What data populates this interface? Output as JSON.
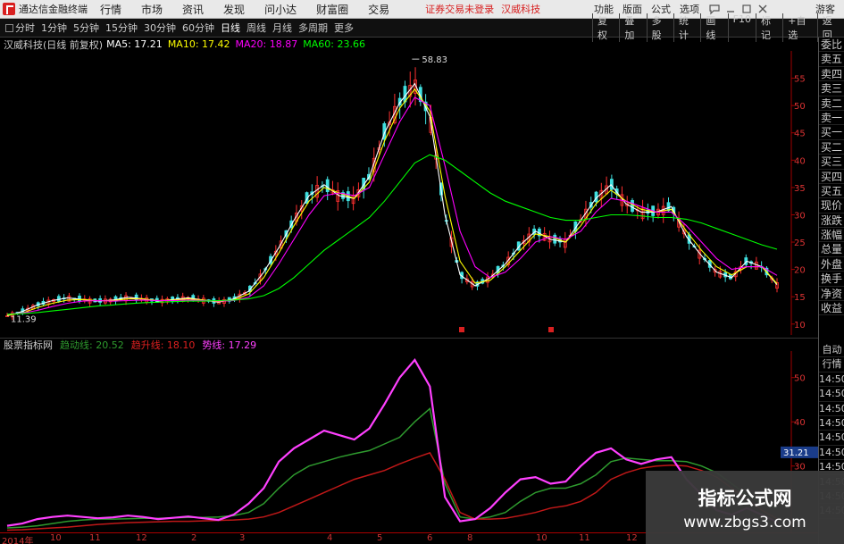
{
  "titlebar": {
    "app_name": "通达信金融终端",
    "menus": [
      "行情",
      "市场",
      "资讯",
      "发现",
      "问小达",
      "财富圈",
      "交易"
    ],
    "warning": "证券交易未登录",
    "stock_name": "汉威科技",
    "right_items": [
      "功能",
      "版面",
      "公式",
      "选项"
    ],
    "guest": "游客"
  },
  "toolbar": {
    "periods": [
      "分时",
      "1分钟",
      "5分钟",
      "15分钟",
      "30分钟",
      "60分钟",
      "日线",
      "周线",
      "月线",
      "多周期",
      "更多"
    ],
    "active_period": "日线",
    "tools": [
      "复权",
      "叠加",
      "多股",
      "统计",
      "画线",
      "F10",
      "标记",
      "+自选",
      "返回"
    ]
  },
  "infobar": {
    "stock_label": "汉威科技(日线 前复权)",
    "ma": [
      {
        "label": "MA5: 17.21",
        "color": "#ffffff"
      },
      {
        "label": "MA10: 17.42",
        "color": "#ffff00"
      },
      {
        "label": "MA20: 18.87",
        "color": "#ff00ff"
      },
      {
        "label": "MA60: 23.66",
        "color": "#00ff00"
      }
    ]
  },
  "right_panel": {
    "upper": [
      "委比",
      "卖五",
      "卖四",
      "卖三",
      "卖二",
      "卖一",
      "买一",
      "买二",
      "买三",
      "买四",
      "买五",
      "现价",
      "涨跌",
      "涨幅",
      "总量",
      "外盘",
      "换手",
      "净资",
      "收益"
    ],
    "lower": [
      "自动",
      "行情",
      "14:50",
      "14:50",
      "14:50",
      "14:50",
      "14:50",
      "14:50",
      "14:50",
      "14:50",
      "14:50",
      "14:50"
    ]
  },
  "indicator": {
    "name": "股票指标网",
    "values": [
      {
        "label": "趋动线: 20.52",
        "color": "#2e9a2e"
      },
      {
        "label": "趋升线: 18.10",
        "color": "#e02020"
      },
      {
        "label": "势线: 17.29",
        "color": "#ff40ff"
      }
    ],
    "current_price_badge": "31.21"
  },
  "time_axis": [
    "2014年",
    "10",
    "11",
    "12",
    "2",
    "3",
    "4",
    "5",
    "6",
    "8",
    "10",
    "11",
    "12"
  ],
  "watermark": {
    "line1": "指标公式网",
    "line2": "www.zbgs3.com"
  },
  "colors": {
    "up": "#ff3030",
    "down": "#40e0e0",
    "ma5": "#ffffff",
    "ma10": "#ffff00",
    "ma20": "#ff00ff",
    "ma60": "#00ff00",
    "axis": "#a00000"
  },
  "chart_data": [
    {
      "type": "candlestick",
      "title": "汉威科技(日线 前复权)",
      "ylim": [
        8,
        60
      ],
      "y_ticks": [
        10,
        15,
        20,
        25,
        30,
        35,
        40,
        45,
        50,
        55
      ],
      "annotations": [
        "58.83",
        "11.39"
      ],
      "series": [
        {
          "name": "MA5",
          "values": [
            11.5,
            12.3,
            13.5,
            14.3,
            14.8,
            14.5,
            14.2,
            14.4,
            14.9,
            14.6,
            14.2,
            14.5,
            14.8,
            14.4,
            14.0,
            14.6,
            16.0,
            19.5,
            24.0,
            29.0,
            33.5,
            35.5,
            33.5,
            33.0,
            37.0,
            45.0,
            50.5,
            54.0,
            48.0,
            30.0,
            19.0,
            17.0,
            18.5,
            21.0,
            24.5,
            27.0,
            25.5,
            25.0,
            29.0,
            33.0,
            35.5,
            32.0,
            30.5,
            30.5,
            31.5,
            26.0,
            22.5,
            19.5,
            18.5,
            21.5,
            20.5,
            17.2
          ]
        },
        {
          "name": "MA10",
          "values": [
            11.6,
            12.0,
            13.0,
            13.8,
            14.4,
            14.5,
            14.3,
            14.3,
            14.6,
            14.6,
            14.3,
            14.4,
            14.6,
            14.4,
            14.1,
            14.4,
            15.5,
            18.5,
            23.0,
            28.0,
            32.5,
            35.0,
            34.0,
            33.0,
            36.0,
            43.5,
            49.5,
            53.0,
            49.0,
            33.5,
            21.5,
            17.5,
            18.0,
            20.5,
            23.5,
            26.5,
            26.0,
            25.0,
            28.0,
            32.0,
            34.5,
            32.5,
            31.0,
            30.5,
            31.0,
            27.0,
            23.5,
            20.5,
            19.0,
            20.5,
            20.5,
            17.4
          ]
        },
        {
          "name": "MA20",
          "values": [
            11.8,
            12.0,
            12.5,
            13.2,
            13.8,
            14.2,
            14.3,
            14.2,
            14.3,
            14.4,
            14.3,
            14.3,
            14.4,
            14.3,
            14.2,
            14.3,
            14.9,
            17.0,
            21.0,
            25.5,
            30.0,
            33.5,
            34.0,
            33.5,
            35.0,
            41.0,
            47.0,
            51.5,
            50.0,
            39.0,
            27.0,
            20.5,
            18.5,
            19.5,
            22.0,
            25.0,
            26.0,
            25.5,
            27.0,
            30.5,
            33.0,
            32.5,
            31.5,
            30.5,
            30.5,
            28.0,
            25.0,
            22.0,
            20.0,
            20.5,
            20.5,
            18.9
          ]
        },
        {
          "name": "MA60",
          "values": [
            11.8,
            11.9,
            12.1,
            12.4,
            12.7,
            13.0,
            13.3,
            13.5,
            13.7,
            13.9,
            14.0,
            14.1,
            14.2,
            14.2,
            14.3,
            14.4,
            14.6,
            15.2,
            16.5,
            18.5,
            21.0,
            23.5,
            25.5,
            27.5,
            29.5,
            32.5,
            36.0,
            39.5,
            41.0,
            40.0,
            38.0,
            36.0,
            34.0,
            32.5,
            31.5,
            30.5,
            29.5,
            29.0,
            29.0,
            29.5,
            30.0,
            30.0,
            29.8,
            29.5,
            29.5,
            29.2,
            28.5,
            27.5,
            26.5,
            25.5,
            24.5,
            23.7
          ]
        }
      ]
    },
    {
      "type": "line",
      "title": "股票指标网",
      "ylim": [
        15,
        56
      ],
      "y_ticks": [
        30,
        40,
        50
      ],
      "series": [
        {
          "name": "趋动线",
          "values": [
            16.0,
            16.2,
            16.5,
            17.0,
            17.5,
            17.8,
            18.0,
            18.0,
            18.1,
            18.2,
            18.2,
            18.3,
            18.4,
            18.4,
            18.5,
            18.8,
            19.5,
            21.5,
            25.0,
            28.0,
            30.0,
            31.0,
            32.0,
            32.8,
            33.5,
            35.0,
            36.5,
            40.0,
            43.0,
            26.0,
            18.5,
            18.0,
            18.5,
            19.5,
            22.0,
            24.0,
            25.0,
            25.0,
            26.0,
            28.0,
            31.0,
            31.8,
            31.5,
            31.2,
            31.2,
            31.0,
            30.0,
            28.5,
            26.0,
            23.5,
            21.5,
            20.5
          ]
        },
        {
          "name": "趋升线",
          "values": [
            15.5,
            15.6,
            15.8,
            16.0,
            16.2,
            16.5,
            16.8,
            17.0,
            17.2,
            17.3,
            17.4,
            17.5,
            17.5,
            17.6,
            17.7,
            17.8,
            18.0,
            18.5,
            19.5,
            21.0,
            22.5,
            24.0,
            25.5,
            27.0,
            28.0,
            29.0,
            30.5,
            31.8,
            33.0,
            27.0,
            19.5,
            18.0,
            18.0,
            18.2,
            18.8,
            19.5,
            20.5,
            21.0,
            22.0,
            24.0,
            27.0,
            28.5,
            29.5,
            30.0,
            30.2,
            30.0,
            29.0,
            27.5,
            25.0,
            22.5,
            20.0,
            18.1
          ]
        },
        {
          "name": "势线",
          "values": [
            16.5,
            17.0,
            18.0,
            18.5,
            18.8,
            18.5,
            18.2,
            18.4,
            18.8,
            18.5,
            18.0,
            18.3,
            18.6,
            18.2,
            17.8,
            19.0,
            21.5,
            25.0,
            31.0,
            34.0,
            36.0,
            38.0,
            37.0,
            36.0,
            38.5,
            44.0,
            50.0,
            54.0,
            48.0,
            23.0,
            17.5,
            18.0,
            20.5,
            24.0,
            27.0,
            27.5,
            26.0,
            26.5,
            30.0,
            33.0,
            34.0,
            31.5,
            30.5,
            31.5,
            32.0,
            27.0,
            23.5,
            20.0,
            19.0,
            20.5,
            19.0,
            17.3
          ]
        }
      ]
    }
  ]
}
